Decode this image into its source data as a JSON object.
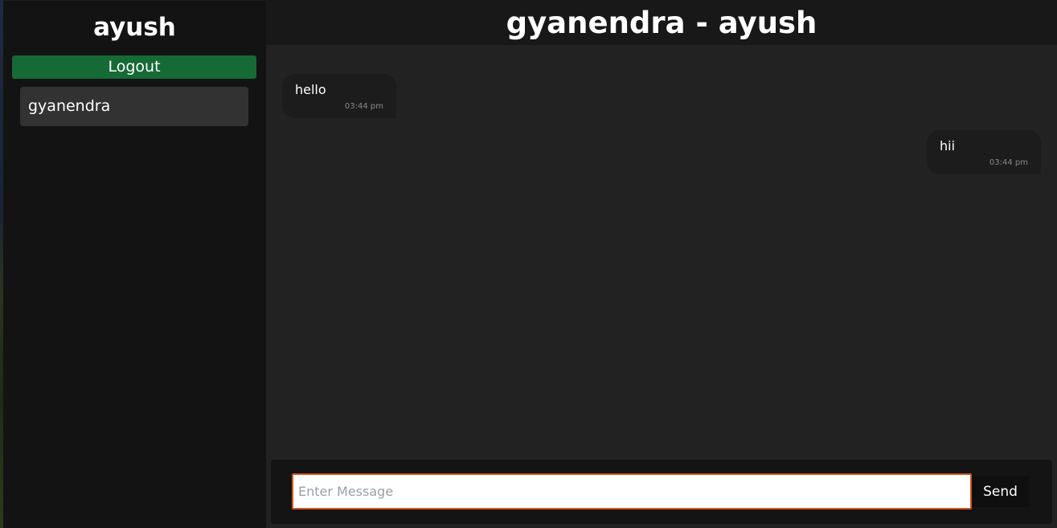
{
  "sidebar": {
    "username": "ayush",
    "logout_label": "Logout",
    "contacts": [
      {
        "name": "gyanendra"
      }
    ]
  },
  "chat": {
    "title": "gyanendra - ayush",
    "messages": [
      {
        "text": "hello",
        "time": "03:44 pm",
        "side": "left"
      },
      {
        "text": "hii",
        "time": "03:44 pm",
        "side": "right"
      }
    ],
    "input_placeholder": "Enter Message",
    "input_value": "",
    "send_label": "Send"
  },
  "colors": {
    "accent_green": "#166a36",
    "input_border": "#d2551f"
  }
}
